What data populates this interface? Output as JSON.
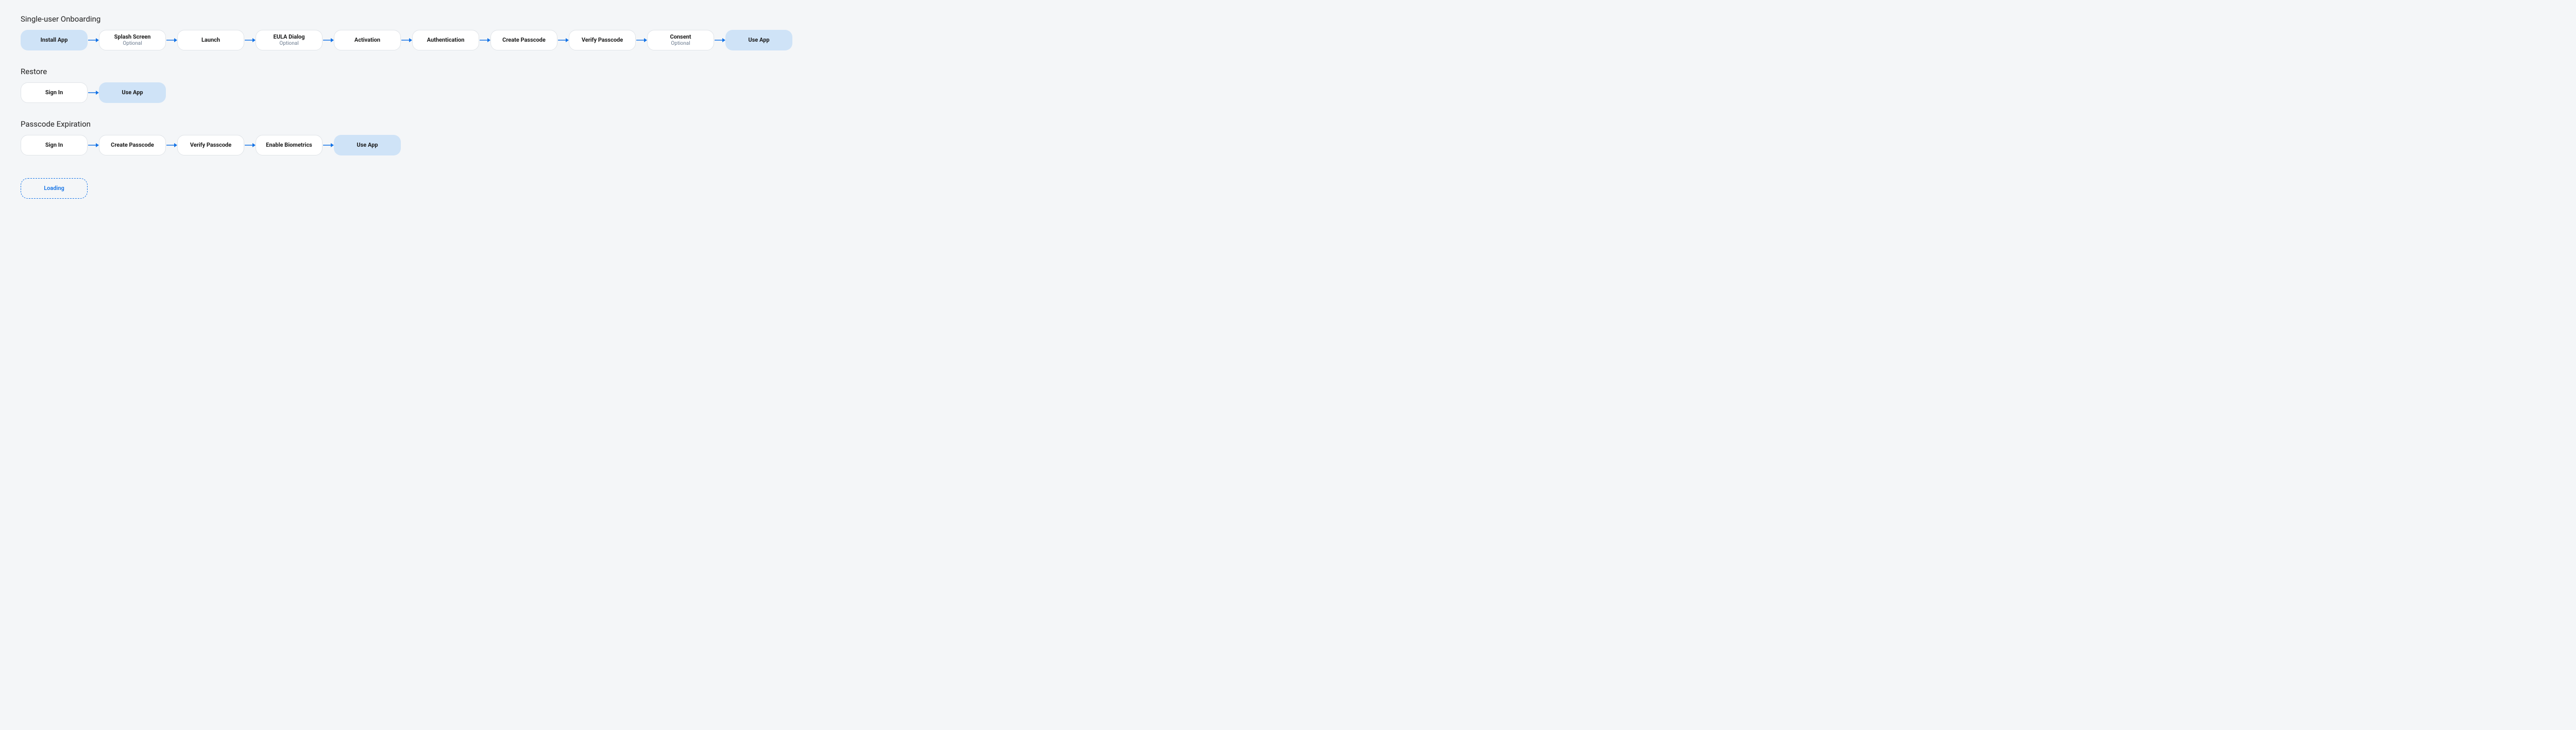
{
  "sections": [
    {
      "title": "Single-user Onboarding",
      "steps": [
        {
          "label": "Install App",
          "style": "blue-solid",
          "subtext": ""
        },
        {
          "label": "Splash Screen",
          "style": "white",
          "subtext": "Optional"
        },
        {
          "label": "Launch",
          "style": "white",
          "subtext": ""
        },
        {
          "label": "EULA Dialog",
          "style": "white",
          "subtext": "Optional"
        },
        {
          "label": "Activation",
          "style": "white",
          "subtext": ""
        },
        {
          "label": "Authentication",
          "style": "white",
          "subtext": ""
        },
        {
          "label": "Create Passcode",
          "style": "white",
          "subtext": ""
        },
        {
          "label": "Verify Passcode",
          "style": "white",
          "subtext": ""
        },
        {
          "label": "Consent",
          "style": "white",
          "subtext": "Optional"
        },
        {
          "label": "Use App",
          "style": "blue-solid",
          "subtext": ""
        }
      ]
    },
    {
      "title": "Restore",
      "steps": [
        {
          "label": "Sign In",
          "style": "white",
          "subtext": ""
        },
        {
          "label": "Use App",
          "style": "blue-solid",
          "subtext": ""
        }
      ]
    },
    {
      "title": "Passcode Expiration",
      "steps": [
        {
          "label": "Sign In",
          "style": "white",
          "subtext": ""
        },
        {
          "label": "Create Passcode",
          "style": "white",
          "subtext": ""
        },
        {
          "label": "Verify Passcode",
          "style": "white",
          "subtext": ""
        },
        {
          "label": "Enable Biometrics",
          "style": "white",
          "subtext": ""
        },
        {
          "label": "Use App",
          "style": "blue-solid",
          "subtext": ""
        }
      ]
    }
  ],
  "loading_node": {
    "label": "Loading",
    "style": "dashed"
  },
  "colors": {
    "background": "#f4f6f8",
    "node_white_bg": "#ffffff",
    "node_white_border": "#e0e4e8",
    "node_blue_bg": "#cfe3f7",
    "accent_blue": "#1473e6",
    "subtext": "#6b7b8f",
    "text": "#1a1a1a"
  }
}
